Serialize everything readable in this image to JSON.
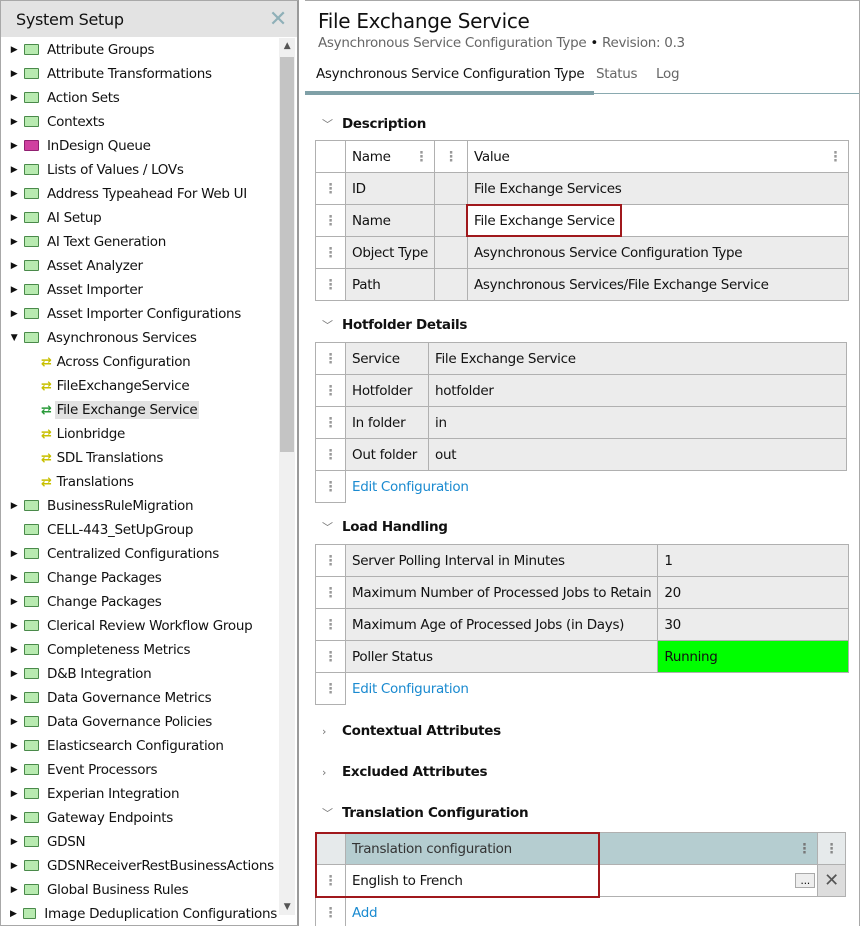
{
  "sidebar": {
    "title": "System Setup",
    "items": [
      {
        "label": "Attribute Groups",
        "exp": "closed",
        "icon": "folder"
      },
      {
        "label": "Attribute Transformations",
        "exp": "closed",
        "icon": "folder"
      },
      {
        "label": "Action Sets",
        "exp": "closed",
        "icon": "folder"
      },
      {
        "label": "Contexts",
        "exp": "closed",
        "icon": "folder"
      },
      {
        "label": "InDesign Queue",
        "exp": "closed",
        "icon": "pink"
      },
      {
        "label": "Lists of Values / LOVs",
        "exp": "closed",
        "icon": "folder"
      },
      {
        "label": "Address Typeahead For Web UI",
        "exp": "closed",
        "icon": "folder"
      },
      {
        "label": "AI Setup",
        "exp": "closed",
        "icon": "folder"
      },
      {
        "label": "AI Text Generation",
        "exp": "closed",
        "icon": "folder"
      },
      {
        "label": "Asset Analyzer",
        "exp": "closed",
        "icon": "folder"
      },
      {
        "label": "Asset Importer",
        "exp": "closed",
        "icon": "folder"
      },
      {
        "label": "Asset Importer Configurations",
        "exp": "closed",
        "icon": "folder"
      },
      {
        "label": "Asynchronous Services",
        "exp": "open",
        "icon": "folder"
      },
      {
        "label": "Across Configuration",
        "exp": "child",
        "icon": "arrow"
      },
      {
        "label": "FileExchangeService",
        "exp": "child",
        "icon": "arrow"
      },
      {
        "label": "File Exchange Service",
        "exp": "child",
        "icon": "arrow",
        "selected": true
      },
      {
        "label": "Lionbridge",
        "exp": "child",
        "icon": "arrow"
      },
      {
        "label": "SDL Translations",
        "exp": "child",
        "icon": "arrow"
      },
      {
        "label": "Translations",
        "exp": "child",
        "icon": "arrow"
      },
      {
        "label": "BusinessRuleMigration",
        "exp": "closed",
        "icon": "folder"
      },
      {
        "label": "CELL-443_SetUpGroup",
        "exp": "none",
        "icon": "folder"
      },
      {
        "label": "Centralized Configurations",
        "exp": "closed",
        "icon": "folder"
      },
      {
        "label": "Change Packages",
        "exp": "closed",
        "icon": "folder"
      },
      {
        "label": "Change Packages",
        "exp": "closed",
        "icon": "folder"
      },
      {
        "label": "Clerical Review Workflow Group",
        "exp": "closed",
        "icon": "folder"
      },
      {
        "label": "Completeness Metrics",
        "exp": "closed",
        "icon": "folder"
      },
      {
        "label": "D&B Integration",
        "exp": "closed",
        "icon": "folder"
      },
      {
        "label": "Data Governance Metrics",
        "exp": "closed",
        "icon": "folder"
      },
      {
        "label": "Data Governance Policies",
        "exp": "closed",
        "icon": "folder"
      },
      {
        "label": "Elasticsearch Configuration",
        "exp": "closed",
        "icon": "folder"
      },
      {
        "label": "Event Processors",
        "exp": "closed",
        "icon": "folder"
      },
      {
        "label": "Experian Integration",
        "exp": "closed",
        "icon": "folder"
      },
      {
        "label": "Gateway Endpoints",
        "exp": "closed",
        "icon": "folder"
      },
      {
        "label": "GDSN",
        "exp": "closed",
        "icon": "folder"
      },
      {
        "label": "GDSNReceiverRestBusinessActions",
        "exp": "closed",
        "icon": "folder"
      },
      {
        "label": "Global Business Rules",
        "exp": "closed",
        "icon": "folder"
      },
      {
        "label": "Image Deduplication Configurations",
        "exp": "closed",
        "icon": "folder"
      }
    ]
  },
  "header": {
    "title": "File Exchange Service",
    "subtitle": "Asynchronous Service Configuration Type",
    "bullet": "•",
    "revision": "Revision: 0.3"
  },
  "tabs": [
    "Asynchronous Service Configuration Type",
    "Status",
    "Log"
  ],
  "description": {
    "title": "Description",
    "col_name": "Name",
    "col_value": "Value",
    "rows": [
      {
        "name": "ID",
        "value": "File Exchange Services"
      },
      {
        "name": "Name",
        "value": "File Exchange Service"
      },
      {
        "name": "Object Type",
        "value": "Asynchronous Service Configuration Type"
      },
      {
        "name": "Path",
        "value": "Asynchronous Services/File Exchange Service"
      }
    ]
  },
  "hotfolder": {
    "title": "Hotfolder Details",
    "rows": [
      {
        "name": "Service",
        "value": "File Exchange Service"
      },
      {
        "name": "Hotfolder",
        "value": "hotfolder"
      },
      {
        "name": "In folder",
        "value": "in"
      },
      {
        "name": "Out folder",
        "value": "out"
      }
    ],
    "edit": "Edit Configuration"
  },
  "load": {
    "title": "Load Handling",
    "rows": [
      {
        "name": "Server Polling Interval in Minutes",
        "value": "1"
      },
      {
        "name": "Maximum Number of Processed Jobs to Retain",
        "value": "20"
      },
      {
        "name": "Maximum Age of Processed Jobs (in Days)",
        "value": "30"
      },
      {
        "name": "Poller Status",
        "value": "Running"
      }
    ],
    "edit": "Edit Configuration",
    "running_color": "#00ff00"
  },
  "contextual": {
    "title": "Contextual Attributes"
  },
  "excluded": {
    "title": "Excluded Attributes"
  },
  "translation": {
    "title": "Translation Configuration",
    "col": "Translation configuration",
    "rows": [
      "English to French"
    ],
    "browse": "...",
    "add": "Add"
  }
}
